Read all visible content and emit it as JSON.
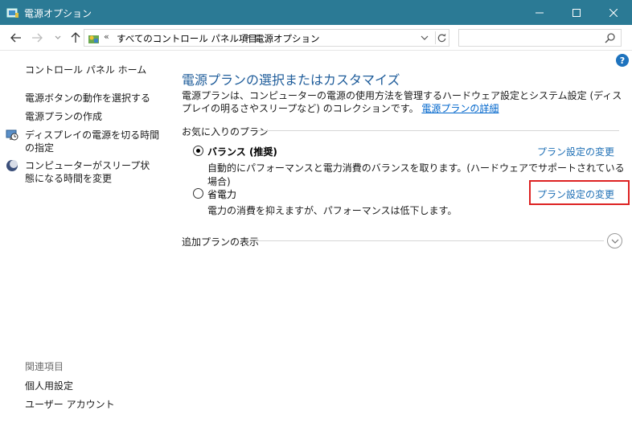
{
  "window": {
    "title": "電源オプション"
  },
  "navigation": {
    "breadcrumb_overflow": "«",
    "breadcrumbs": [
      "すべてのコントロール パネル項目",
      "電源オプション"
    ],
    "separator": ">",
    "search_placeholder": ""
  },
  "sidebar": {
    "home": "コントロール パネル ホーム",
    "tasks": [
      "電源ボタンの動作を選択する",
      "電源プランの作成",
      "ディスプレイの電源を切る時間の指定",
      "コンピューターがスリープ状態になる時間を変更"
    ],
    "see_also_header": "関連項目",
    "see_also": [
      "個人用設定",
      "ユーザー アカウント"
    ]
  },
  "main": {
    "help": "?",
    "heading": "電源プランの選択またはカスタマイズ",
    "description": "電源プランは、コンピューターの電源の使用方法を管理するハードウェア設定とシステム設定 (ディスプレイの明るさやスリープなど) のコレクションです。",
    "description_link": "電源プランの詳細",
    "favorites_header": "お気に入りのプラン",
    "plans": [
      {
        "name": "バランス (推奨)",
        "selected": true,
        "description": "自動的にパフォーマンスと電力消費のバランスを取ります。(ハードウェアでサポートされている場合)",
        "link": "プラン設定の変更"
      },
      {
        "name": "省電力",
        "selected": false,
        "description": "電力の消費を抑えますが、パフォーマンスは低下します。",
        "link": "プラン設定の変更"
      }
    ],
    "additional_plans": "追加プランの表示"
  },
  "colors": {
    "titlebar": "#2b7a95",
    "heading": "#1e5c9a",
    "link": "#1e6fb5",
    "highlight": "#dd2222"
  }
}
